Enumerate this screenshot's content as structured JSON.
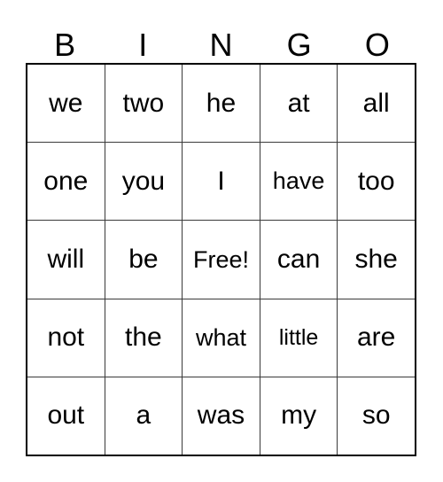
{
  "card": {
    "title": "BINGO",
    "background_color": "#ffffff",
    "text_color": "#000000",
    "border_color": "#000000",
    "grid_line_color": "#3a3a3a",
    "columns": 5,
    "rows": 5
  },
  "header": {
    "letters": [
      "B",
      "I",
      "N",
      "G",
      "O"
    ]
  },
  "grid": {
    "rows": [
      {
        "cells": [
          {
            "label": "we",
            "free": false
          },
          {
            "label": "two",
            "free": false
          },
          {
            "label": "he",
            "free": false
          },
          {
            "label": "at",
            "free": false
          },
          {
            "label": "all",
            "free": false
          }
        ]
      },
      {
        "cells": [
          {
            "label": "one",
            "free": false
          },
          {
            "label": "you",
            "free": false
          },
          {
            "label": "I",
            "free": false
          },
          {
            "label": "have",
            "free": false
          },
          {
            "label": "too",
            "free": false
          }
        ]
      },
      {
        "cells": [
          {
            "label": "will",
            "free": false
          },
          {
            "label": "be",
            "free": false
          },
          {
            "label": "Free!",
            "free": true
          },
          {
            "label": "can",
            "free": false
          },
          {
            "label": "she",
            "free": false
          }
        ]
      },
      {
        "cells": [
          {
            "label": "not",
            "free": false
          },
          {
            "label": "the",
            "free": false
          },
          {
            "label": "what",
            "free": false
          },
          {
            "label": "little",
            "free": false
          },
          {
            "label": "are",
            "free": false
          }
        ]
      },
      {
        "cells": [
          {
            "label": "out",
            "free": false
          },
          {
            "label": "a",
            "free": false
          },
          {
            "label": "was",
            "free": false
          },
          {
            "label": "my",
            "free": false
          },
          {
            "label": "so",
            "free": false
          }
        ]
      }
    ]
  }
}
